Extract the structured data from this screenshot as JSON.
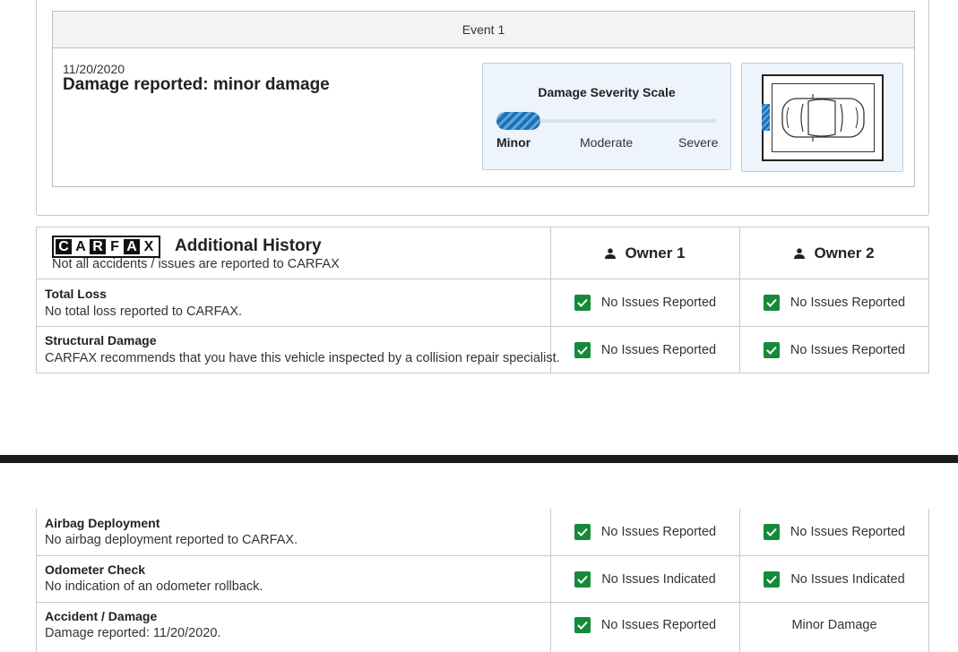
{
  "event": {
    "header": "Event 1",
    "date": "11/20/2020",
    "title": "Damage reported: minor damage",
    "severity": {
      "title": "Damage Severity Scale",
      "levels": [
        "Minor",
        "Moderate",
        "Severe"
      ],
      "selected": "Minor",
      "level_fraction": 0.2
    },
    "impact_side": "left-front",
    "accent_color": "#1f6fb5"
  },
  "additional_history": {
    "logo_letters": [
      "C",
      "A",
      "R",
      "F",
      "A",
      "X"
    ],
    "title": "Additional History",
    "subtitle": "Not all accidents / issues are reported to CARFAX",
    "owners": [
      "Owner 1",
      "Owner 2"
    ],
    "rows": [
      {
        "title": "Total Loss",
        "desc": "No total loss reported to CARFAX.",
        "owner1": "No Issues Reported",
        "owner2": "No Issues Reported"
      },
      {
        "title": "Structural Damage",
        "desc": "CARFAX recommends that you have this vehicle inspected by a collision repair specialist.",
        "owner1": "No Issues Reported",
        "owner2": "No Issues Reported"
      }
    ]
  },
  "continued": {
    "rows": [
      {
        "title": "Airbag Deployment",
        "desc": "No airbag deployment reported to CARFAX.",
        "owner1": "No Issues Reported",
        "owner2": "No Issues Reported"
      },
      {
        "title": "Odometer Check",
        "desc": "No indication of an odometer rollback.",
        "owner1": "No Issues Indicated",
        "owner2": "No Issues Indicated"
      },
      {
        "title": "Accident / Damage",
        "desc": "Damage reported: 11/20/2020.",
        "owner1": "No Issues Reported",
        "owner2": "Minor Damage"
      }
    ]
  },
  "colors": {
    "check": "#168a3a",
    "border": "#c8c8c8",
    "divider": "#1c1c1c"
  },
  "icons": [
    "check-icon",
    "person-icon",
    "car-top-icon"
  ]
}
